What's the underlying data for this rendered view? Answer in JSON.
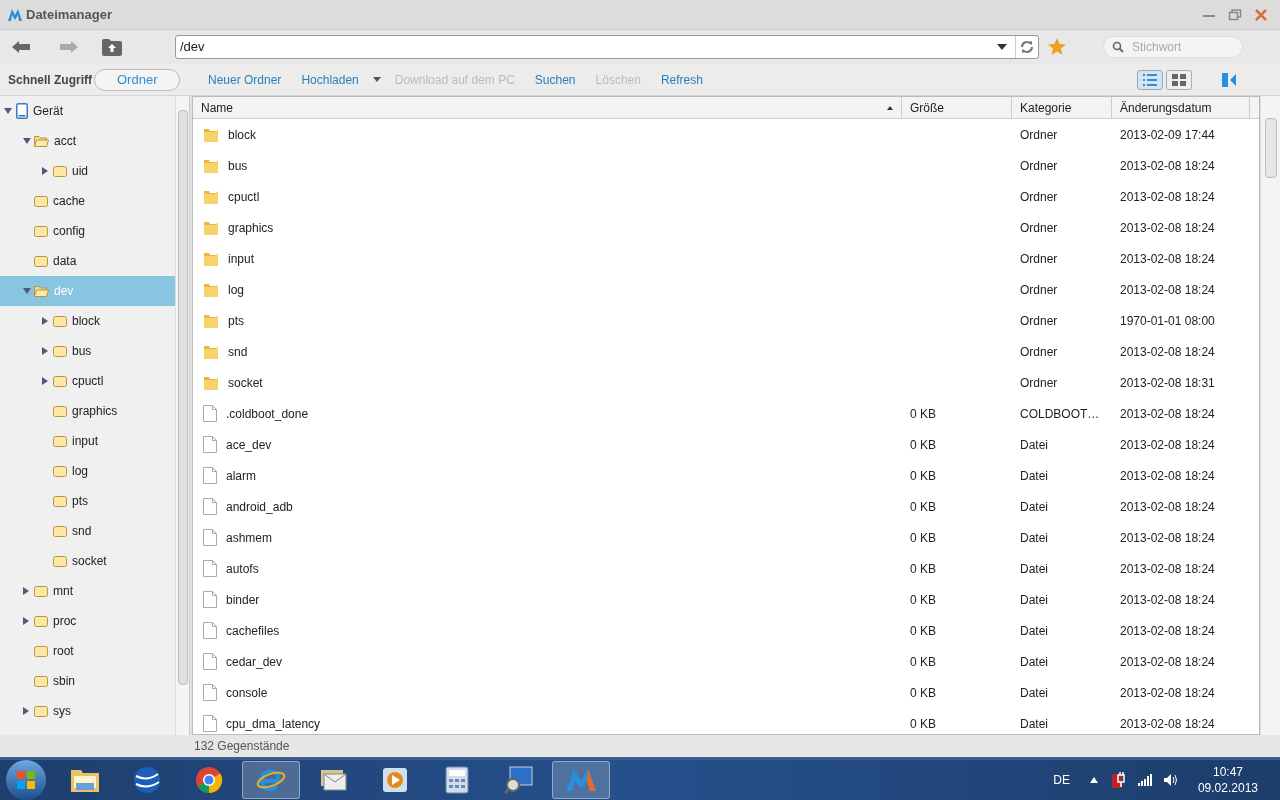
{
  "window": {
    "title": "Dateimanager"
  },
  "address_bar": {
    "value": "/dev"
  },
  "search": {
    "placeholder": "Stichwort"
  },
  "panel_tabs": [
    {
      "label": "Schnell Zugriff",
      "selected": false
    },
    {
      "label": "Ordner",
      "selected": true
    }
  ],
  "actions": [
    {
      "label": "Neuer Ordner",
      "disabled": false,
      "menu": false
    },
    {
      "label": "Hochladen",
      "disabled": false,
      "menu": true
    },
    {
      "label": "Download auf dem PC",
      "disabled": true,
      "menu": false
    },
    {
      "label": "Suchen",
      "disabled": false,
      "menu": false
    },
    {
      "label": "Löschen",
      "disabled": true,
      "menu": false
    },
    {
      "label": "Refresh",
      "disabled": false,
      "menu": false
    }
  ],
  "view_modes": [
    {
      "kind": "list",
      "selected": true
    },
    {
      "kind": "grid",
      "selected": false
    }
  ],
  "tree": [
    {
      "label": "Gerät",
      "kind": "device",
      "expanded": true,
      "selected": false,
      "children": [
        {
          "label": "acct",
          "kind": "folder",
          "expanded": true,
          "selected": false,
          "children": [
            {
              "label": "uid",
              "kind": "folder",
              "expanded": false,
              "selected": false
            }
          ]
        },
        {
          "label": "cache",
          "kind": "folder",
          "selected": false
        },
        {
          "label": "config",
          "kind": "folder",
          "selected": false
        },
        {
          "label": "data",
          "kind": "folder",
          "selected": false
        },
        {
          "label": "dev",
          "kind": "folder",
          "expanded": true,
          "selected": true,
          "children": [
            {
              "label": "block",
              "kind": "folder",
              "expanded": false,
              "selected": false
            },
            {
              "label": "bus",
              "kind": "folder",
              "expanded": false,
              "selected": false
            },
            {
              "label": "cpuctl",
              "kind": "folder",
              "expanded": false,
              "selected": false
            },
            {
              "label": "graphics",
              "kind": "folder",
              "selected": false
            },
            {
              "label": "input",
              "kind": "folder",
              "selected": false
            },
            {
              "label": "log",
              "kind": "folder",
              "selected": false
            },
            {
              "label": "pts",
              "kind": "folder",
              "selected": false
            },
            {
              "label": "snd",
              "kind": "folder",
              "selected": false
            },
            {
              "label": "socket",
              "kind": "folder",
              "selected": false
            }
          ]
        },
        {
          "label": "mnt",
          "kind": "folder",
          "expanded": false,
          "selected": false
        },
        {
          "label": "proc",
          "kind": "folder",
          "expanded": false,
          "selected": false
        },
        {
          "label": "root",
          "kind": "folder",
          "selected": false
        },
        {
          "label": "sbin",
          "kind": "folder",
          "selected": false
        },
        {
          "label": "sys",
          "kind": "folder",
          "expanded": false,
          "selected": false
        }
      ]
    }
  ],
  "table": {
    "columns": [
      "Name",
      "Größe",
      "Kategorie",
      "Änderungsdatum"
    ],
    "rows": [
      {
        "kind": "folder",
        "name": "block",
        "size": "",
        "category": "Ordner",
        "modified": "2013-02-09 17:44"
      },
      {
        "kind": "folder",
        "name": "bus",
        "size": "",
        "category": "Ordner",
        "modified": "2013-02-08 18:24"
      },
      {
        "kind": "folder",
        "name": "cpuctl",
        "size": "",
        "category": "Ordner",
        "modified": "2013-02-08 18:24"
      },
      {
        "kind": "folder",
        "name": "graphics",
        "size": "",
        "category": "Ordner",
        "modified": "2013-02-08 18:24"
      },
      {
        "kind": "folder",
        "name": "input",
        "size": "",
        "category": "Ordner",
        "modified": "2013-02-08 18:24"
      },
      {
        "kind": "folder",
        "name": "log",
        "size": "",
        "category": "Ordner",
        "modified": "2013-02-08 18:24"
      },
      {
        "kind": "folder",
        "name": "pts",
        "size": "",
        "category": "Ordner",
        "modified": "1970-01-01 08:00"
      },
      {
        "kind": "folder",
        "name": "snd",
        "size": "",
        "category": "Ordner",
        "modified": "2013-02-08 18:24"
      },
      {
        "kind": "folder",
        "name": "socket",
        "size": "",
        "category": "Ordner",
        "modified": "2013-02-08 18:31"
      },
      {
        "kind": "file",
        "name": ".coldboot_done",
        "size": "0 KB",
        "category": "COLDBOOT…",
        "modified": "2013-02-08 18:24"
      },
      {
        "kind": "file",
        "name": "ace_dev",
        "size": "0 KB",
        "category": "Datei",
        "modified": "2013-02-08 18:24"
      },
      {
        "kind": "file",
        "name": "alarm",
        "size": "0 KB",
        "category": "Datei",
        "modified": "2013-02-08 18:24"
      },
      {
        "kind": "file",
        "name": "android_adb",
        "size": "0 KB",
        "category": "Datei",
        "modified": "2013-02-08 18:24"
      },
      {
        "kind": "file",
        "name": "ashmem",
        "size": "0 KB",
        "category": "Datei",
        "modified": "2013-02-08 18:24"
      },
      {
        "kind": "file",
        "name": "autofs",
        "size": "0 KB",
        "category": "Datei",
        "modified": "2013-02-08 18:24"
      },
      {
        "kind": "file",
        "name": "binder",
        "size": "0 KB",
        "category": "Datei",
        "modified": "2013-02-08 18:24"
      },
      {
        "kind": "file",
        "name": "cachefiles",
        "size": "0 KB",
        "category": "Datei",
        "modified": "2013-02-08 18:24"
      },
      {
        "kind": "file",
        "name": "cedar_dev",
        "size": "0 KB",
        "category": "Datei",
        "modified": "2013-02-08 18:24"
      },
      {
        "kind": "file",
        "name": "console",
        "size": "0 KB",
        "category": "Datei",
        "modified": "2013-02-08 18:24"
      },
      {
        "kind": "file",
        "name": "cpu_dma_latency",
        "size": "0 KB",
        "category": "Datei",
        "modified": "2013-02-08 18:24"
      }
    ]
  },
  "status_bar": {
    "text": "132 Gegenstände"
  },
  "taskbar": {
    "items": [
      {
        "kind": "explorer",
        "selected": false
      },
      {
        "kind": "globe",
        "selected": false
      },
      {
        "kind": "chrome",
        "selected": false
      },
      {
        "kind": "ie",
        "selected": true
      },
      {
        "kind": "mail",
        "selected": false
      },
      {
        "kind": "media",
        "selected": false
      },
      {
        "kind": "calculator",
        "selected": false
      },
      {
        "kind": "network",
        "selected": false
      },
      {
        "kind": "app",
        "selected": true
      }
    ],
    "language": "DE",
    "time": "10:47",
    "date": "09.02.2013"
  }
}
